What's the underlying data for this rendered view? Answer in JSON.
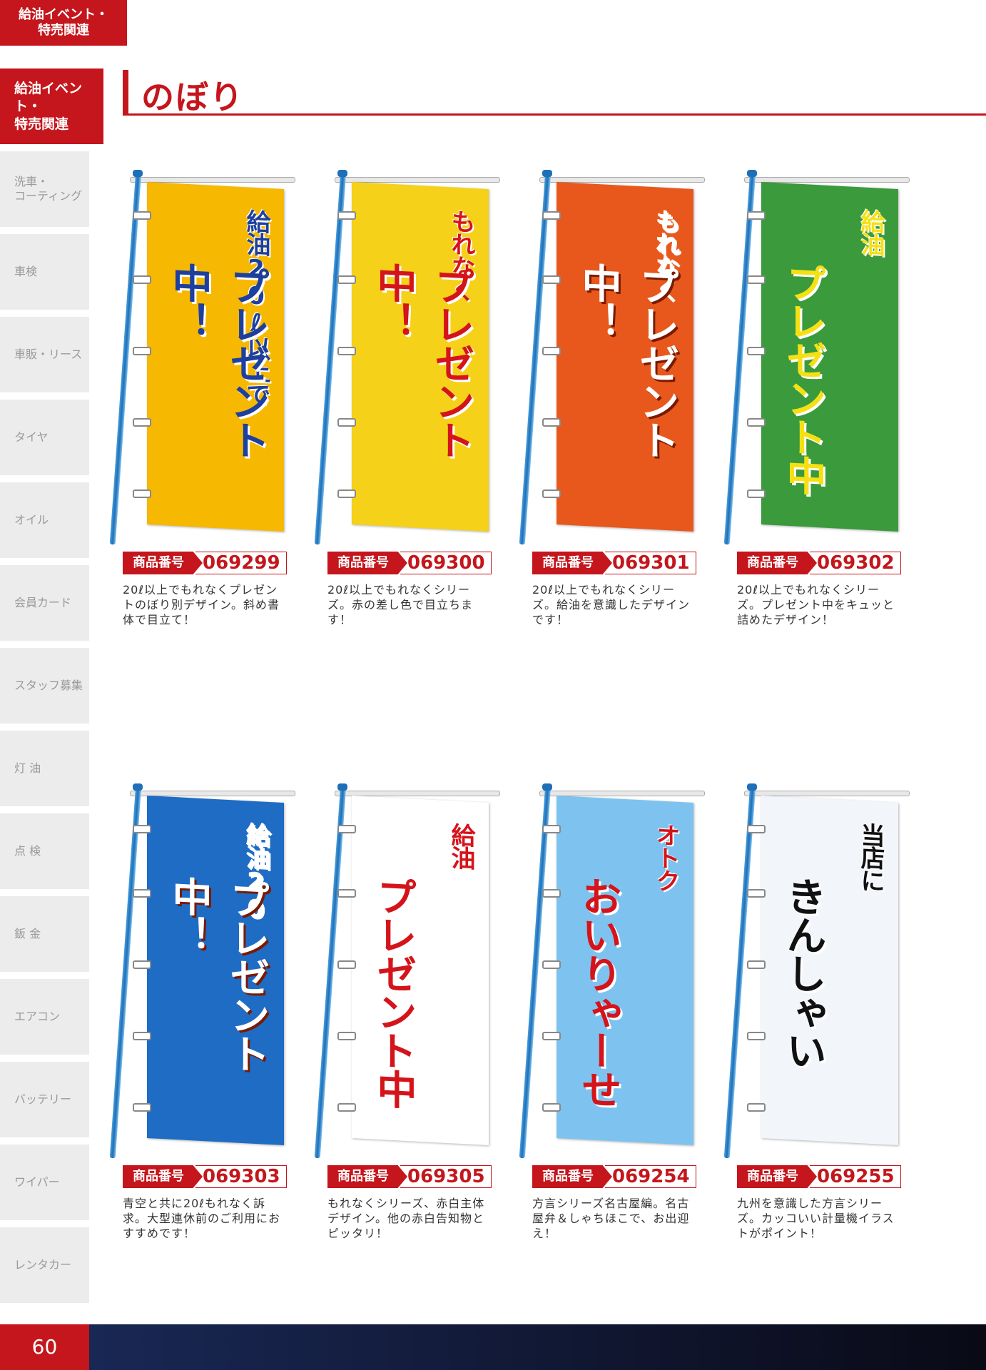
{
  "top_tab": {
    "line1": "給油イベント・",
    "line2": "特売関連"
  },
  "sidebar": {
    "items": [
      {
        "label": "給油イベント・\n特売関連",
        "active": true
      },
      {
        "label": "洗車・\nコーティング"
      },
      {
        "label": "車検"
      },
      {
        "label": "車販・リース"
      },
      {
        "label": "タイヤ"
      },
      {
        "label": "オイル"
      },
      {
        "label": "会員カード"
      },
      {
        "label": "スタッフ募集"
      },
      {
        "label": "灯 油"
      },
      {
        "label": "点 検"
      },
      {
        "label": "鈑 金"
      },
      {
        "label": "エアコン"
      },
      {
        "label": "バッテリー"
      },
      {
        "label": "ワイパー"
      },
      {
        "label": "レンタカー"
      }
    ]
  },
  "page_title": "のぼり",
  "code_label": "商品番号",
  "products": [
    {
      "code": "069299",
      "description": "20ℓ以上でもれなくプレゼントのぼり別デザイン。斜め書体で目立て！",
      "banner_text": "プレゼント中！",
      "sub_text": "給油20ℓ以上で",
      "bg": "#f6b800",
      "fg": "#1d3f9e"
    },
    {
      "code": "069300",
      "description": "20ℓ以上でもれなくシリーズ。赤の差し色で目立ちます！",
      "banner_text": "プレゼント中！",
      "sub_text": "もれなく",
      "bg": "#f5d11a",
      "fg": "#d4141a"
    },
    {
      "code": "069301",
      "description": "20ℓ以上でもれなくシリーズ。給油を意識したデザインです！",
      "banner_text": "プレゼント中！",
      "sub_text": "もれなく",
      "bg": "#e8581c",
      "fg": "#ffffff"
    },
    {
      "code": "069302",
      "description": "20ℓ以上でもれなくシリーズ。プレゼント中をキュッと詰めたデザイン！",
      "banner_text": "プレゼント中",
      "sub_text": "給油",
      "bg": "#3a9a3c",
      "fg": "#f5e014"
    },
    {
      "code": "069303",
      "description": "青空と共に20ℓもれなく訴求。大型連休前のご利用におすすめです！",
      "banner_text": "プレゼント中！",
      "sub_text": "給油20",
      "bg": "#1f6cc4",
      "fg": "#ffffff"
    },
    {
      "code": "069305",
      "description": "もれなくシリーズ、赤白主体デザイン。他の赤白告知物とピッタリ！",
      "banner_text": "プレゼント中",
      "sub_text": "給油",
      "bg": "#ffffff",
      "fg": "#d4141a"
    },
    {
      "code": "069254",
      "description": "方言シリーズ名古屋編。名古屋弁＆しゃちほこで、お出迎え！",
      "banner_text": "おいりゃーせ",
      "sub_text": "オトク",
      "bg": "#7ec3ef",
      "fg": "#d4141a"
    },
    {
      "code": "069255",
      "description": "九州を意識した方言シリーズ。カッコいい計量機イラストがポイント！",
      "banner_text": "きんしゃい",
      "sub_text": "当店に",
      "bg": "#f2f6fa",
      "fg": "#111111"
    }
  ],
  "footer": {
    "page_number": "60"
  }
}
